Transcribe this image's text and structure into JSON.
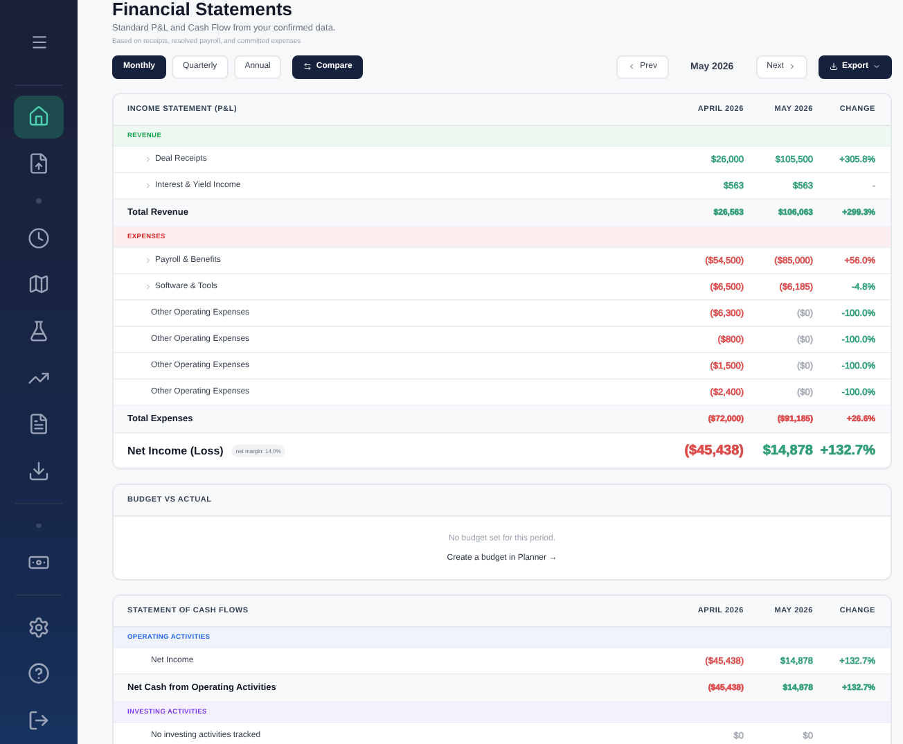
{
  "sidebar": {
    "items": [
      {
        "selected": true
      },
      {
        "selected": false
      },
      {
        "selected": false
      },
      {
        "selected": false
      },
      {
        "selected": false
      },
      {
        "selected": false
      },
      {
        "selected": false
      },
      {
        "selected": false
      },
      {
        "selected": false
      }
    ]
  },
  "header": {
    "title": "Financial Statements",
    "subtitle": "Standard P&L and Cash Flow from your confirmed data.",
    "note": "Based on receipts, resolved payroll, and committed expenses"
  },
  "toolbar": {
    "periods": [
      {
        "label": "Monthly",
        "selected": true
      },
      {
        "label": "Quarterly",
        "selected": false
      },
      {
        "label": "Annual",
        "selected": false
      }
    ],
    "compare": "Compare",
    "prev": "Prev",
    "period": "May 2026",
    "next": "Next",
    "export": "Export"
  },
  "income_statement": {
    "title": "INCOME STATEMENT (P&L)",
    "columns": [
      "APRIL 2026",
      "MAY 2026",
      "CHANGE"
    ],
    "rows": [
      {
        "kind": "section",
        "label": "REVENUE",
        "color": "#16a34a"
      },
      {
        "kind": "item",
        "label": "Deal Receipts",
        "expandable": true,
        "cells": [
          {
            "text": "$26,000",
            "color": "#2f9e74"
          },
          {
            "text": "$105,500",
            "color": "#2f9e74"
          },
          {
            "text": "+305.8%",
            "color": "#2f9e74"
          }
        ]
      },
      {
        "kind": "item",
        "label": "Interest & Yield Income",
        "expandable": true,
        "cells": [
          {
            "text": "$563",
            "color": "#2f9e74"
          },
          {
            "text": "$563",
            "color": "#2f9e74"
          },
          {
            "text": "-",
            "color": "#a8adb5"
          }
        ]
      },
      {
        "kind": "total",
        "label": "Total Revenue",
        "cells": [
          {
            "text": "$26,563",
            "color": "#2f9e74"
          },
          {
            "text": "$106,063",
            "color": "#2f9e74"
          },
          {
            "text": "+299.3%",
            "color": "#2f9e74"
          }
        ]
      },
      {
        "kind": "section",
        "label": "EXPENSES",
        "color": "#dc2626"
      },
      {
        "kind": "item",
        "label": "Payroll & Benefits",
        "expandable": true,
        "cells": [
          {
            "text": "($54,500)",
            "color": "#dc4a4a"
          },
          {
            "text": "($85,000)",
            "color": "#dc4a4a"
          },
          {
            "text": "+56.0%",
            "color": "#dc4a4a"
          }
        ]
      },
      {
        "kind": "item",
        "label": "Software & Tools",
        "expandable": true,
        "cells": [
          {
            "text": "($6,500)",
            "color": "#dc4a4a"
          },
          {
            "text": "($6,185)",
            "color": "#dc4a4a"
          },
          {
            "text": "-4.8%",
            "color": "#2f9e74"
          }
        ]
      },
      {
        "kind": "item",
        "label": "Other Operating Expenses",
        "expandable": false,
        "cells": [
          {
            "text": "($6,300)",
            "color": "#dc4a4a"
          },
          {
            "text": "($0)",
            "color": "#a8adb5"
          },
          {
            "text": "-100.0%",
            "color": "#2f9e74"
          }
        ]
      },
      {
        "kind": "item",
        "label": "Other Operating Expenses",
        "expandable": false,
        "cells": [
          {
            "text": "($800)",
            "color": "#dc4a4a"
          },
          {
            "text": "($0)",
            "color": "#a8adb5"
          },
          {
            "text": "-100.0%",
            "color": "#2f9e74"
          }
        ]
      },
      {
        "kind": "item",
        "label": "Other Operating Expenses",
        "expandable": false,
        "cells": [
          {
            "text": "($1,500)",
            "color": "#dc4a4a"
          },
          {
            "text": "($0)",
            "color": "#a8adb5"
          },
          {
            "text": "-100.0%",
            "color": "#2f9e74"
          }
        ]
      },
      {
        "kind": "item",
        "label": "Other Operating Expenses",
        "expandable": false,
        "cells": [
          {
            "text": "($2,400)",
            "color": "#dc4a4a"
          },
          {
            "text": "($0)",
            "color": "#a8adb5"
          },
          {
            "text": "-100.0%",
            "color": "#2f9e74"
          }
        ]
      },
      {
        "kind": "total",
        "label": "Total Expenses",
        "cells": [
          {
            "text": "($72,000)",
            "color": "#dc4a4a"
          },
          {
            "text": "($91,185)",
            "color": "#dc4a4a"
          },
          {
            "text": "+26.6%",
            "color": "#dc4a4a"
          }
        ]
      },
      {
        "kind": "net",
        "label": "Net Income (Loss)",
        "badge": "net margin: 14.0%",
        "cells": [
          {
            "text": "($45,438)",
            "color": "#dc4a4a"
          },
          {
            "text": "$14,878",
            "color": "#2f9e74"
          },
          {
            "text": "+132.7%",
            "color": "#2f9e74"
          }
        ]
      }
    ]
  },
  "budget": {
    "title": "BUDGET VS ACTUAL",
    "message": "No budget set for this period.",
    "link": "Create a budget in Planner →"
  },
  "cash_flow": {
    "title": "STATEMENT OF CASH FLOWS",
    "columns": [
      "APRIL 2026",
      "MAY 2026",
      "CHANGE"
    ],
    "rows": [
      {
        "kind": "section",
        "label": "OPERATING ACTIVITIES",
        "color": "#2563eb"
      },
      {
        "kind": "item",
        "label": "Net Income",
        "expandable": false,
        "cells": [
          {
            "text": "($45,438)",
            "color": "#dc4a4a"
          },
          {
            "text": "$14,878",
            "color": "#2f9e74"
          },
          {
            "text": "+132.7%",
            "color": "#2f9e74"
          }
        ]
      },
      {
        "kind": "total",
        "label": "Net Cash from Operating Activities",
        "cells": [
          {
            "text": "($45,438)",
            "color": "#dc4a4a"
          },
          {
            "text": "$14,878",
            "color": "#2f9e74"
          },
          {
            "text": "+132.7%",
            "color": "#2f9e74"
          }
        ]
      },
      {
        "kind": "section",
        "label": "INVESTING ACTIVITIES",
        "color": "#7c3aed"
      },
      {
        "kind": "item",
        "label": "No investing activities tracked",
        "expandable": false,
        "cells": [
          {
            "text": "$0",
            "color": "#a8adb5"
          },
          {
            "text": "$0",
            "color": "#a8adb5"
          }
        ]
      }
    ]
  }
}
